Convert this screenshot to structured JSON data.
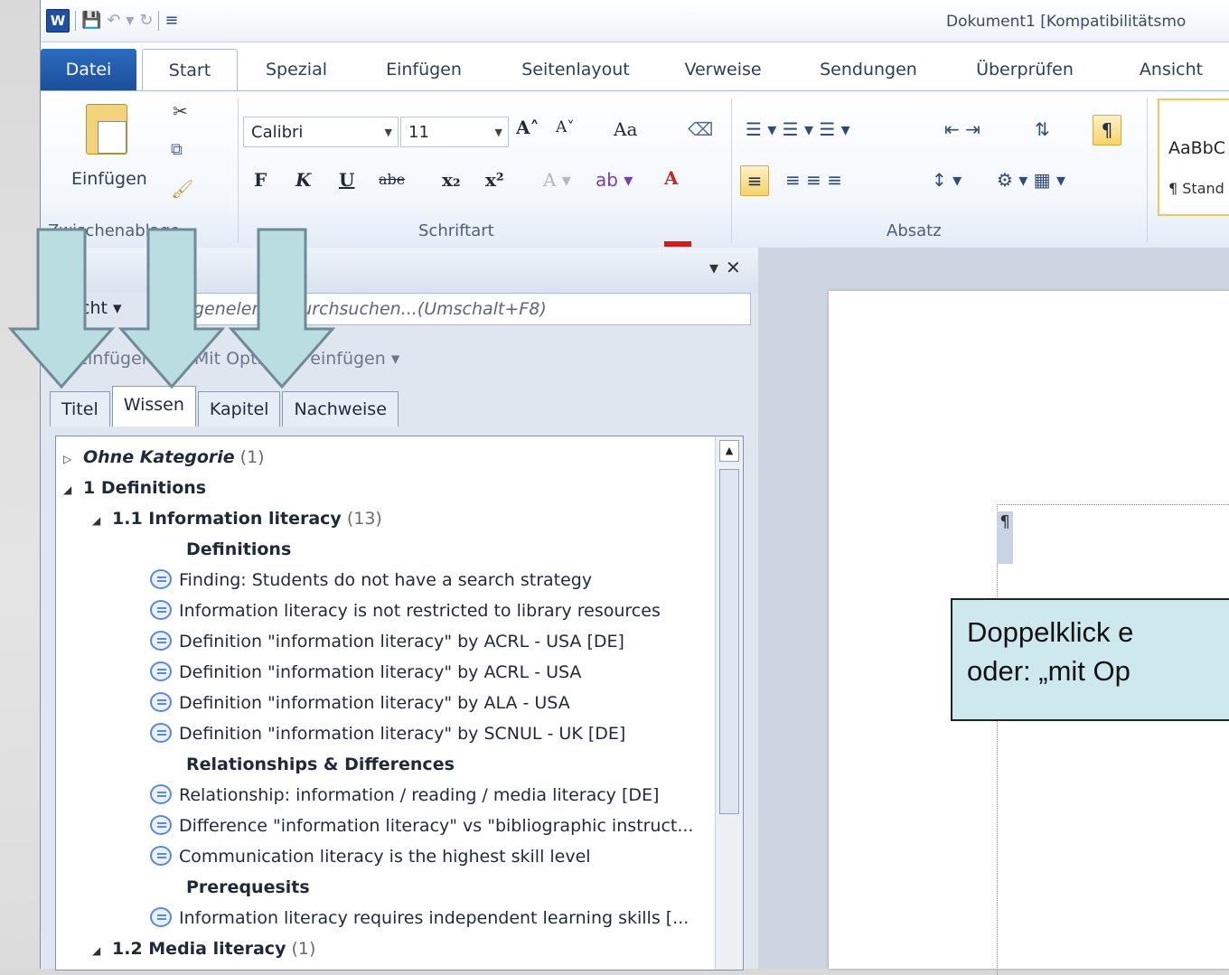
{
  "window": {
    "title": "Dokument1 [Kompatibilitätsmo",
    "app_logo": "W"
  },
  "quick_access": {
    "icons": [
      "save-icon",
      "undo-icon",
      "redo-icon",
      "customize-icon"
    ]
  },
  "ribbon_tabs": [
    "Datei",
    "Start",
    "Spezial",
    "Einfügen",
    "Seitenlayout",
    "Verweise",
    "Sendungen",
    "Überprüfen",
    "Ansicht"
  ],
  "active_tab": "Start",
  "clipboard": {
    "paste_label": "Einfügen",
    "group_label": "Zwischenablage"
  },
  "font": {
    "name": "Calibri",
    "size": "11",
    "group_label": "Schriftart",
    "bold": "F",
    "italic": "K",
    "underline": "U",
    "strike": "abe",
    "subscript": "x₂",
    "superscript": "x²",
    "grow": "A˄",
    "shrink": "A˅",
    "change_case": "Aa"
  },
  "paragraph": {
    "group_label": "Absatz",
    "show_marks": "¶"
  },
  "styles": {
    "preview": "AaBbC",
    "name": "¶ Stand"
  },
  "nav_pane": {
    "title": "vi",
    "view_label": "cht ▾",
    "search_placeholder": "genelem... durchsuchen...(Umschalt+F8)",
    "insert_label": "Einfügen",
    "insert_options_label": "Mit Optionen einfügen ▾",
    "tabs": [
      "Titel",
      "Wissen",
      "Kapitel",
      "Nachweise"
    ],
    "active_tab": "Wissen"
  },
  "tree": {
    "rows": [
      {
        "kind": "category",
        "caret": "▷",
        "text": "Ohne Kategorie",
        "count": "(1)",
        "italic": true
      },
      {
        "kind": "category",
        "caret": "◢",
        "text": "1 Definitions",
        "count": ""
      },
      {
        "kind": "subcategory",
        "caret": "◢",
        "text": "1.1 Information literacy",
        "count": "(13)"
      },
      {
        "kind": "heading",
        "text": "Definitions"
      },
      {
        "kind": "item",
        "text": "Finding: Students do not have a search strategy"
      },
      {
        "kind": "item",
        "text": "Information literacy is not restricted to library resources"
      },
      {
        "kind": "item",
        "text": "Definition \"information literacy\" by ACRL - USA [DE]"
      },
      {
        "kind": "item",
        "text": "Definition \"information literacy\" by ACRL - USA"
      },
      {
        "kind": "item",
        "text": "Definition \"information literacy\" by ALA - USA"
      },
      {
        "kind": "item",
        "text": "Definition \"information literacy\" by SCNUL - UK [DE]"
      },
      {
        "kind": "heading",
        "text": "Relationships & Differences"
      },
      {
        "kind": "item",
        "text": "Relationship: information / reading / media literacy [DE]"
      },
      {
        "kind": "item",
        "text": "Difference \"information literacy\" vs \"bibliographic instruct..."
      },
      {
        "kind": "item",
        "text": "Communication literacy is the highest skill level"
      },
      {
        "kind": "heading",
        "text": "Prerequesits"
      },
      {
        "kind": "item",
        "text": "Information literacy requires independent learning skills [..."
      },
      {
        "kind": "subcategory",
        "caret": "◢",
        "text": "1.2 Media literacy",
        "count": "(1)"
      }
    ]
  },
  "document": {
    "pilcrow": "¶"
  },
  "callout": {
    "line1": "Doppelklick e",
    "line2": "oder: „mit Op"
  },
  "colors": {
    "accent": "#1b4f99",
    "arrow_fill": "#b9dde1",
    "arrow_stroke": "#6f8a99",
    "callout_bg": "#cde9ee"
  }
}
